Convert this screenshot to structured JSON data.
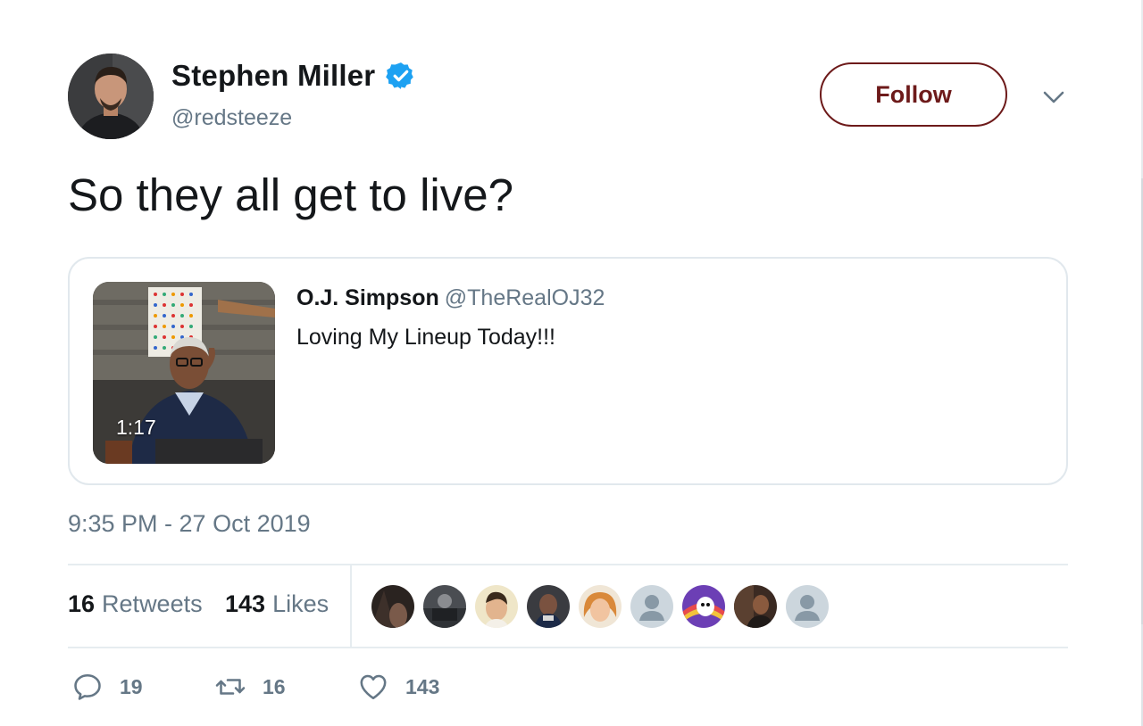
{
  "author": {
    "name": "Stephen Miller",
    "handle": "@redsteeze",
    "verified": true
  },
  "follow_label": "Follow",
  "tweet_text": "So they all get to live?",
  "quoted": {
    "name": "O.J. Simpson",
    "handle": "@TheRealOJ32",
    "text": "Loving My Lineup Today!!!",
    "video_duration": "1:17"
  },
  "timestamp": "9:35 PM - 27 Oct 2019",
  "stats": {
    "retweets_count": "16",
    "retweets_label": "Retweets",
    "likes_count": "143",
    "likes_label": "Likes"
  },
  "actions": {
    "reply_count": "19",
    "retweet_count": "16",
    "like_count": "143"
  },
  "colors": {
    "follow_accent": "#6d1a1a",
    "verified_badge": "#1da1f2",
    "secondary_text": "#657786"
  }
}
